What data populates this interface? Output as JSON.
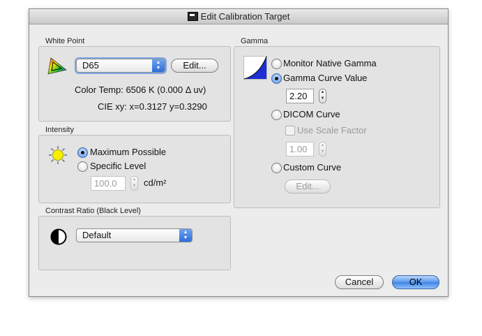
{
  "window": {
    "title": "Edit Calibration Target"
  },
  "white_point": {
    "section_label": "White Point",
    "preset_value": "D65",
    "edit_label": "Edit...",
    "color_temp": "Color Temp: 6506 K (0.000 Δ uv)",
    "cie_xy": "CIE xy: x=0.3127 y=0.3290"
  },
  "intensity": {
    "section_label": "Intensity",
    "option_max": "Maximum Possible",
    "option_specific": "Specific Level",
    "level_value": "100.0",
    "unit": "cd/m²"
  },
  "contrast": {
    "section_label": "Contrast Ratio (Black Level)",
    "preset_value": "Default"
  },
  "gamma": {
    "section_label": "Gamma",
    "option_native": "Monitor Native Gamma",
    "option_curve_value": "Gamma Curve Value",
    "curve_value": "2.20",
    "option_dicom": "DICOM Curve",
    "use_scale_factor": "Use Scale Factor",
    "scale_factor_value": "1.00",
    "option_custom": "Custom Curve",
    "custom_edit_label": "Edit..."
  },
  "buttons": {
    "cancel": "Cancel",
    "ok": "OK"
  },
  "colors": {
    "accent": "#3f83e8",
    "window_bg": "#ececec",
    "group_bg": "#e3e3e3"
  }
}
